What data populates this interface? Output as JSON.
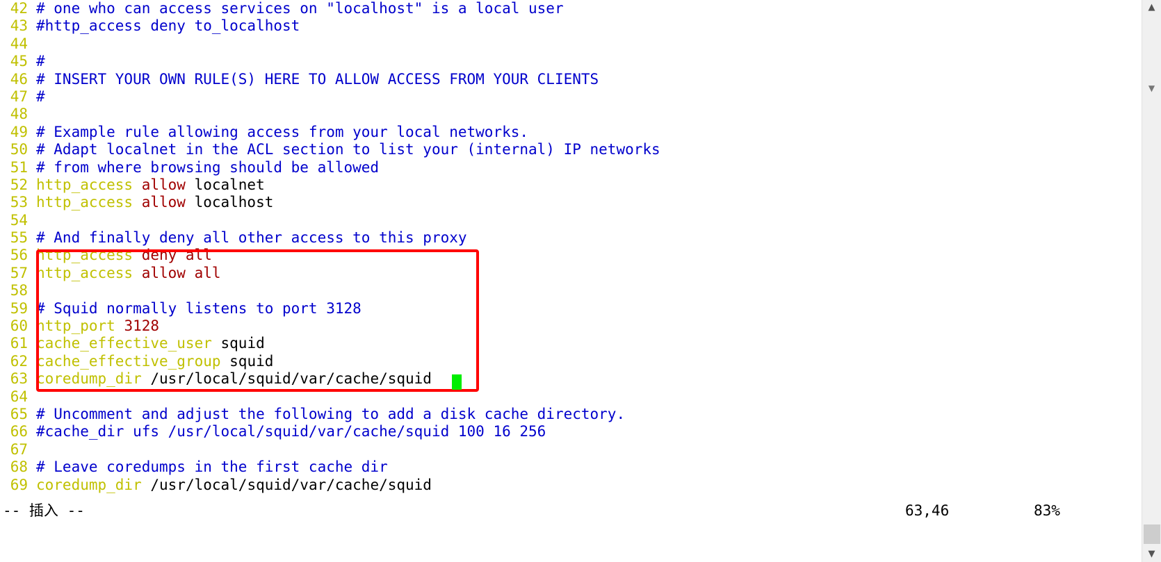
{
  "editor": {
    "app": "vim",
    "filetype": "squid.conf",
    "lines": [
      {
        "num": "42",
        "tokens": [
          {
            "text": "# one who can access services on \"localhost\" is a local user",
            "cls": "c-comment"
          }
        ]
      },
      {
        "num": "43",
        "tokens": [
          {
            "text": "#http_access deny to_localhost",
            "cls": "c-comment"
          }
        ]
      },
      {
        "num": "44",
        "tokens": [
          {
            "text": "",
            "cls": "c-plain"
          }
        ]
      },
      {
        "num": "45",
        "tokens": [
          {
            "text": "#",
            "cls": "c-comment"
          }
        ]
      },
      {
        "num": "46",
        "tokens": [
          {
            "text": "# INSERT YOUR OWN RULE(S) HERE TO ALLOW ACCESS FROM YOUR CLIENTS",
            "cls": "c-comment"
          }
        ]
      },
      {
        "num": "47",
        "tokens": [
          {
            "text": "#",
            "cls": "c-comment"
          }
        ]
      },
      {
        "num": "48",
        "tokens": [
          {
            "text": "",
            "cls": "c-plain"
          }
        ]
      },
      {
        "num": "49",
        "tokens": [
          {
            "text": "# Example rule allowing access from your local networks.",
            "cls": "c-comment"
          }
        ]
      },
      {
        "num": "50",
        "tokens": [
          {
            "text": "# Adapt localnet in the ACL section to list your (internal) IP networks",
            "cls": "c-comment"
          }
        ]
      },
      {
        "num": "51",
        "tokens": [
          {
            "text": "# from where browsing should be allowed",
            "cls": "c-comment"
          }
        ]
      },
      {
        "num": "52",
        "tokens": [
          {
            "text": "http_access ",
            "cls": "c-keyword"
          },
          {
            "text": "allow ",
            "cls": "c-value"
          },
          {
            "text": "localnet",
            "cls": "c-plain"
          }
        ]
      },
      {
        "num": "53",
        "tokens": [
          {
            "text": "http_access ",
            "cls": "c-keyword"
          },
          {
            "text": "allow ",
            "cls": "c-value"
          },
          {
            "text": "localhost",
            "cls": "c-plain"
          }
        ]
      },
      {
        "num": "54",
        "tokens": [
          {
            "text": "",
            "cls": "c-plain"
          }
        ]
      },
      {
        "num": "55",
        "tokens": [
          {
            "text": "# And finally deny all other access to this proxy",
            "cls": "c-comment"
          }
        ]
      },
      {
        "num": "56",
        "tokens": [
          {
            "text": "http_access ",
            "cls": "c-keyword"
          },
          {
            "text": "deny all",
            "cls": "c-value"
          }
        ]
      },
      {
        "num": "57",
        "tokens": [
          {
            "text": "http_access ",
            "cls": "c-keyword"
          },
          {
            "text": "allow all",
            "cls": "c-value"
          }
        ]
      },
      {
        "num": "58",
        "tokens": [
          {
            "text": "",
            "cls": "c-plain"
          }
        ]
      },
      {
        "num": "59",
        "tokens": [
          {
            "text": "# Squid normally listens to port 3128",
            "cls": "c-comment"
          }
        ]
      },
      {
        "num": "60",
        "tokens": [
          {
            "text": "http_port ",
            "cls": "c-keyword"
          },
          {
            "text": "3128",
            "cls": "c-number"
          }
        ]
      },
      {
        "num": "61",
        "tokens": [
          {
            "text": "cache_effective_user ",
            "cls": "c-keyword"
          },
          {
            "text": "squid",
            "cls": "c-plain"
          }
        ]
      },
      {
        "num": "62",
        "tokens": [
          {
            "text": "cache_effective_group ",
            "cls": "c-keyword"
          },
          {
            "text": "squid",
            "cls": "c-plain"
          }
        ]
      },
      {
        "num": "63",
        "tokens": [
          {
            "text": "coredump_dir ",
            "cls": "c-keyword"
          },
          {
            "text": "/usr/local/squid/var/cache/squid",
            "cls": "c-plain"
          }
        ]
      },
      {
        "num": "64",
        "tokens": [
          {
            "text": "",
            "cls": "c-plain"
          }
        ]
      },
      {
        "num": "65",
        "tokens": [
          {
            "text": "# Uncomment and adjust the following to add a disk cache directory.",
            "cls": "c-comment"
          }
        ]
      },
      {
        "num": "66",
        "tokens": [
          {
            "text": "#cache_dir ufs /usr/local/squid/var/cache/squid 100 16 256",
            "cls": "c-comment"
          }
        ]
      },
      {
        "num": "67",
        "tokens": [
          {
            "text": "",
            "cls": "c-plain"
          }
        ]
      },
      {
        "num": "68",
        "tokens": [
          {
            "text": "# Leave coredumps in the first cache dir",
            "cls": "c-comment"
          }
        ]
      },
      {
        "num": "69",
        "tokens": [
          {
            "text": "coredump_dir ",
            "cls": "c-keyword"
          },
          {
            "text": "/usr/local/squid/var/cache/squid",
            "cls": "c-plain"
          }
        ]
      }
    ]
  },
  "annotation": {
    "shape": "rectangle",
    "color": "#ff0000",
    "covers_lines": "56-63"
  },
  "cursor": {
    "color": "#00ee00",
    "line": "63",
    "column": "46"
  },
  "status": {
    "mode": "-- 插入 --",
    "position": "63,46",
    "percent": "83%"
  },
  "scrollbar": {
    "up_arrow": "︿",
    "down_arrow": "﹀",
    "mark": "﹀"
  },
  "colors": {
    "comment": "#0000cc",
    "keyword": "#c0c000",
    "value": "#a00000",
    "plain": "#000000",
    "line_number": "#c0c000",
    "cursor": "#00ee00",
    "annotation": "#ff0000",
    "background": "#ffffff"
  }
}
